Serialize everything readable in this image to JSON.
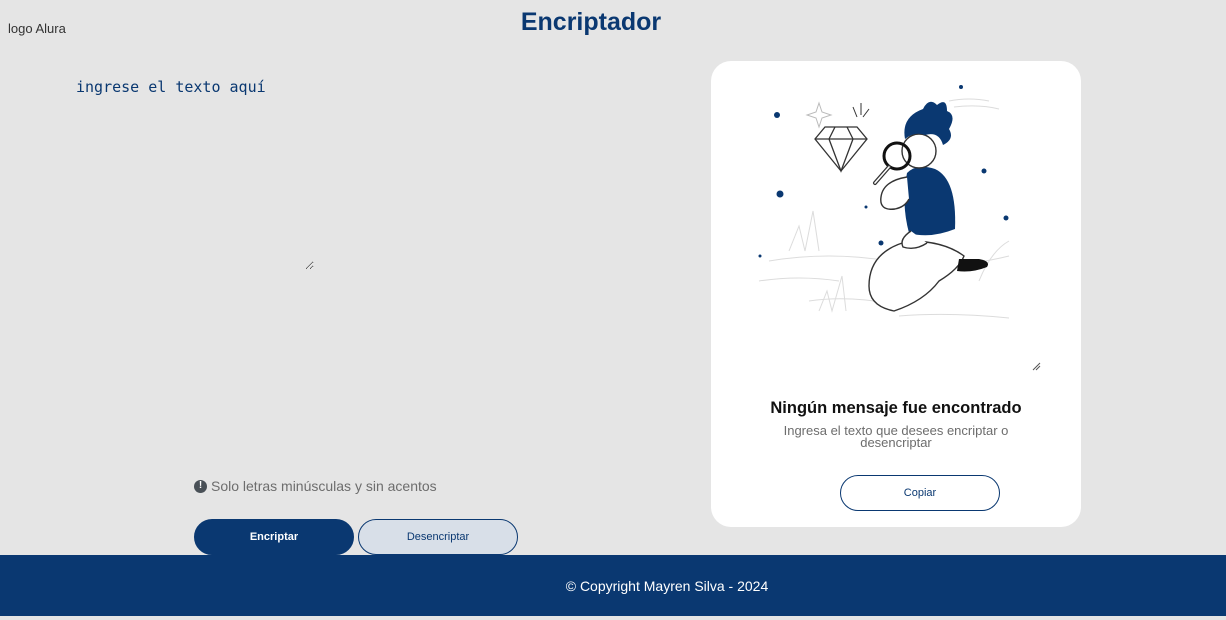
{
  "header": {
    "logo_alt": "logo Alura",
    "title": "Encriptador"
  },
  "input": {
    "placeholder": "ingrese el texto aquí"
  },
  "hint": {
    "icon": "exclamation-circle-icon",
    "text": "Solo letras minúsculas y sin acentos"
  },
  "buttons": {
    "encrypt_label": "Encriptar",
    "decrypt_label": "Desencriptar"
  },
  "output": {
    "title": "Ningún mensaje fue encontrado",
    "subtitle": "Ingresa el texto que desees encriptar o desencriptar",
    "copy_label": "Copiar",
    "illustration": "person-with-magnifier-illustration"
  },
  "footer": {
    "text": "© Copyright Mayren Silva - 2024"
  },
  "colors": {
    "primary": "#0a3871",
    "background": "#e5e5e5",
    "card": "#ffffff",
    "muted": "#6d6d6d"
  }
}
